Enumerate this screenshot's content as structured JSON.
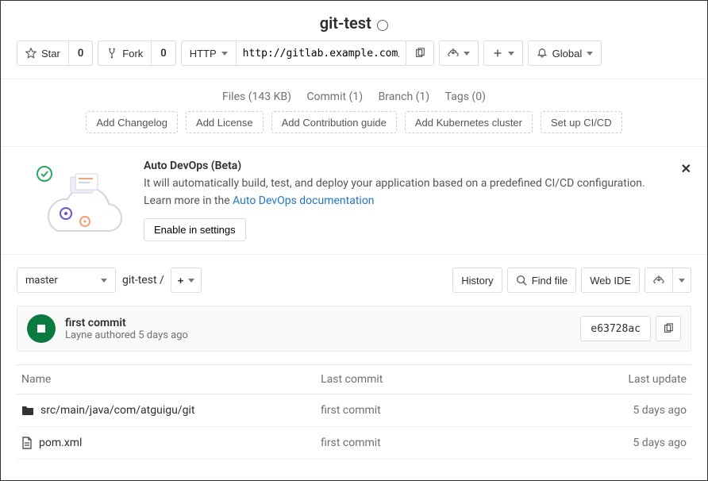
{
  "project": {
    "name": "git-test"
  },
  "toolbar": {
    "star_label": "Star",
    "star_count": "0",
    "fork_label": "Fork",
    "fork_count": "0",
    "protocol": "HTTP",
    "clone_url": "http://gitlab.example.com/roo",
    "notify_label": "Global"
  },
  "stats": {
    "files": "Files (143 KB)",
    "commits": "Commit (1)",
    "branches": "Branch (1)",
    "tags": "Tags (0)"
  },
  "suggestions": {
    "changelog": "Add Changelog",
    "license": "Add License",
    "contrib": "Add Contribution guide",
    "k8s": "Add Kubernetes cluster",
    "cicd": "Set up CI/CD"
  },
  "devops": {
    "title": "Auto DevOps (Beta)",
    "desc": "It will automatically build, test, and deploy your application based on a predefined CI/CD configuration.",
    "learn_prefix": "Learn more in the ",
    "doc_link_label": "Auto DevOps documentation",
    "enable_label": "Enable in settings"
  },
  "nav": {
    "branch": "master",
    "breadcrumb": "git-test",
    "history": "History",
    "findfile": "Find file",
    "webide": "Web IDE"
  },
  "commit": {
    "title": "first commit",
    "author_line": "Layne authored 5 days ago",
    "sha": "e63728ac"
  },
  "table": {
    "headers": {
      "name": "Name",
      "last_commit": "Last commit",
      "last_update": "Last update"
    },
    "rows": [
      {
        "type": "folder",
        "name": "src/main/java/com/atguigu/git",
        "commit": "first commit",
        "update": "5 days ago"
      },
      {
        "type": "file",
        "name": "pom.xml",
        "commit": "first commit",
        "update": "5 days ago"
      }
    ]
  }
}
